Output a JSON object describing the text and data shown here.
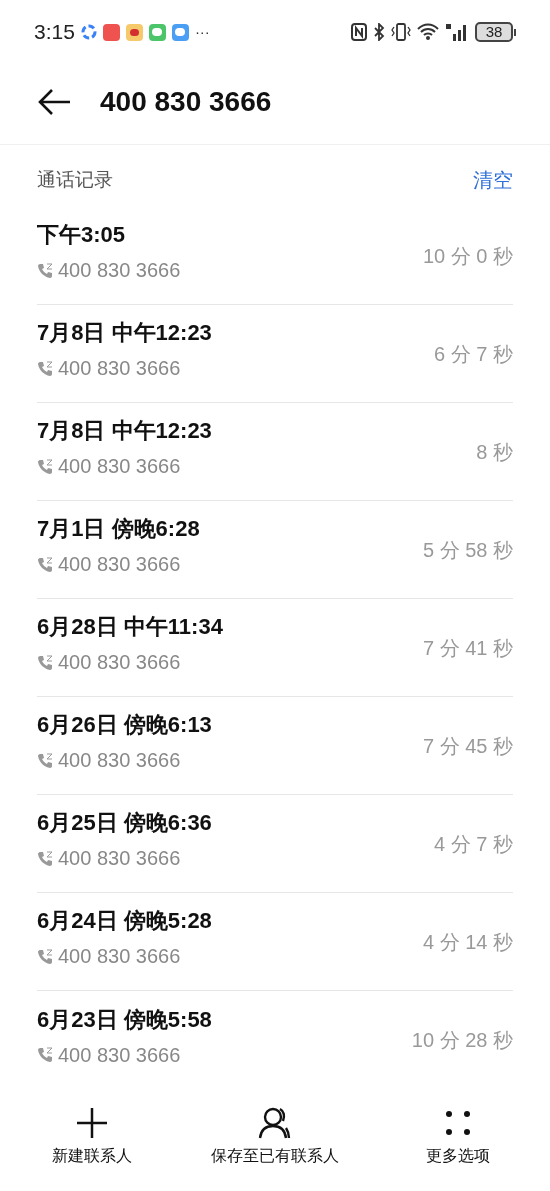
{
  "status_bar": {
    "time": "3:15",
    "more": "···",
    "battery": "38"
  },
  "header": {
    "title": "400 830 3666"
  },
  "section": {
    "title": "通话记录",
    "action": "清空"
  },
  "calls": [
    {
      "time": "下午3:05",
      "number": "400 830 3666",
      "duration": "10 分 0 秒"
    },
    {
      "time": "7月8日 中午12:23",
      "number": "400 830 3666",
      "duration": "6 分 7 秒"
    },
    {
      "time": "7月8日 中午12:23",
      "number": "400 830 3666",
      "duration": "8 秒"
    },
    {
      "time": "7月1日 傍晚6:28",
      "number": "400 830 3666",
      "duration": "5 分 58 秒"
    },
    {
      "time": "6月28日 中午11:34",
      "number": "400 830 3666",
      "duration": "7 分 41 秒"
    },
    {
      "time": "6月26日 傍晚6:13",
      "number": "400 830 3666",
      "duration": "7 分 45 秒"
    },
    {
      "time": "6月25日 傍晚6:36",
      "number": "400 830 3666",
      "duration": "4 分 7 秒"
    },
    {
      "time": "6月24日 傍晚5:28",
      "number": "400 830 3666",
      "duration": "4 分 14 秒"
    },
    {
      "time": "6月23日 傍晚5:58",
      "number": "400 830 3666",
      "duration": "10 分 28 秒"
    }
  ],
  "bottom_actions": [
    {
      "kind": "add",
      "label": "新建联系人"
    },
    {
      "kind": "person",
      "label": "保存至已有联系人"
    },
    {
      "kind": "more",
      "label": "更多选项"
    }
  ]
}
